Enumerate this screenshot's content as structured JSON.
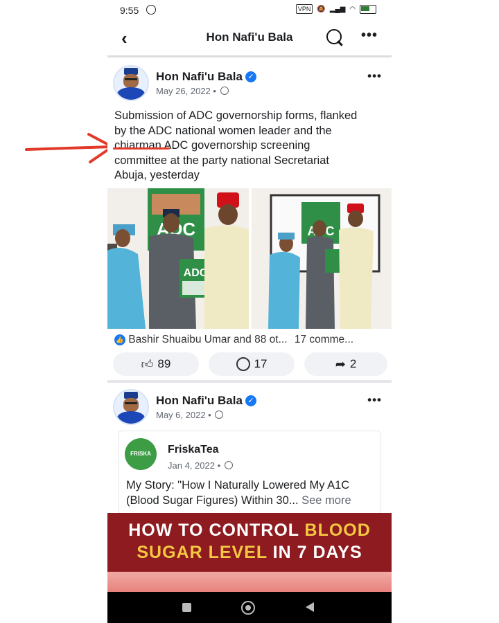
{
  "status": {
    "time": "9:55",
    "vpn": "VPN",
    "battery": "85"
  },
  "header": {
    "title": "Hon Nafi'u Bala"
  },
  "post1": {
    "author": "Hon Nafi'u Bala",
    "date": "May 26, 2022",
    "text_lines": [
      "Submission of ADC governorship forms, flanked",
      "by the ADC national women leader and the",
      "chiarman ADC governorship screening",
      "committee at the party national Secretariat",
      "Abuja, yesterday"
    ],
    "photo_banner_text": "ADC",
    "photo_box_text": "ADC",
    "reactions": "Bashir Shuaibu Umar and 88 ot...",
    "comments_summary": "17 comme...",
    "like_count": "89",
    "comment_count": "17",
    "share_count": "2"
  },
  "post2": {
    "author": "Hon Nafi'u Bala",
    "date": "May 6, 2022",
    "shared": {
      "logo_text": "FRISKA",
      "author": "FriskaTea",
      "date": "Jan 4, 2022",
      "text_line1": "My Story: \"How I Naturally Lowered My A1C",
      "text_line2": "(Blood Sugar Figures) Within 30...",
      "see_more": "See more"
    },
    "banner": {
      "line1_a": "HOW TO CONTROL ",
      "line1_b": "BLOOD",
      "line2_a": "SUGAR LEVEL ",
      "line2_b": "IN 7 DAYS"
    }
  },
  "colors": {
    "arrow": "#e23a2a",
    "accent": "#1877f2",
    "banner_bg": "#8e1b1f",
    "banner_highlight": "#f5c842"
  }
}
